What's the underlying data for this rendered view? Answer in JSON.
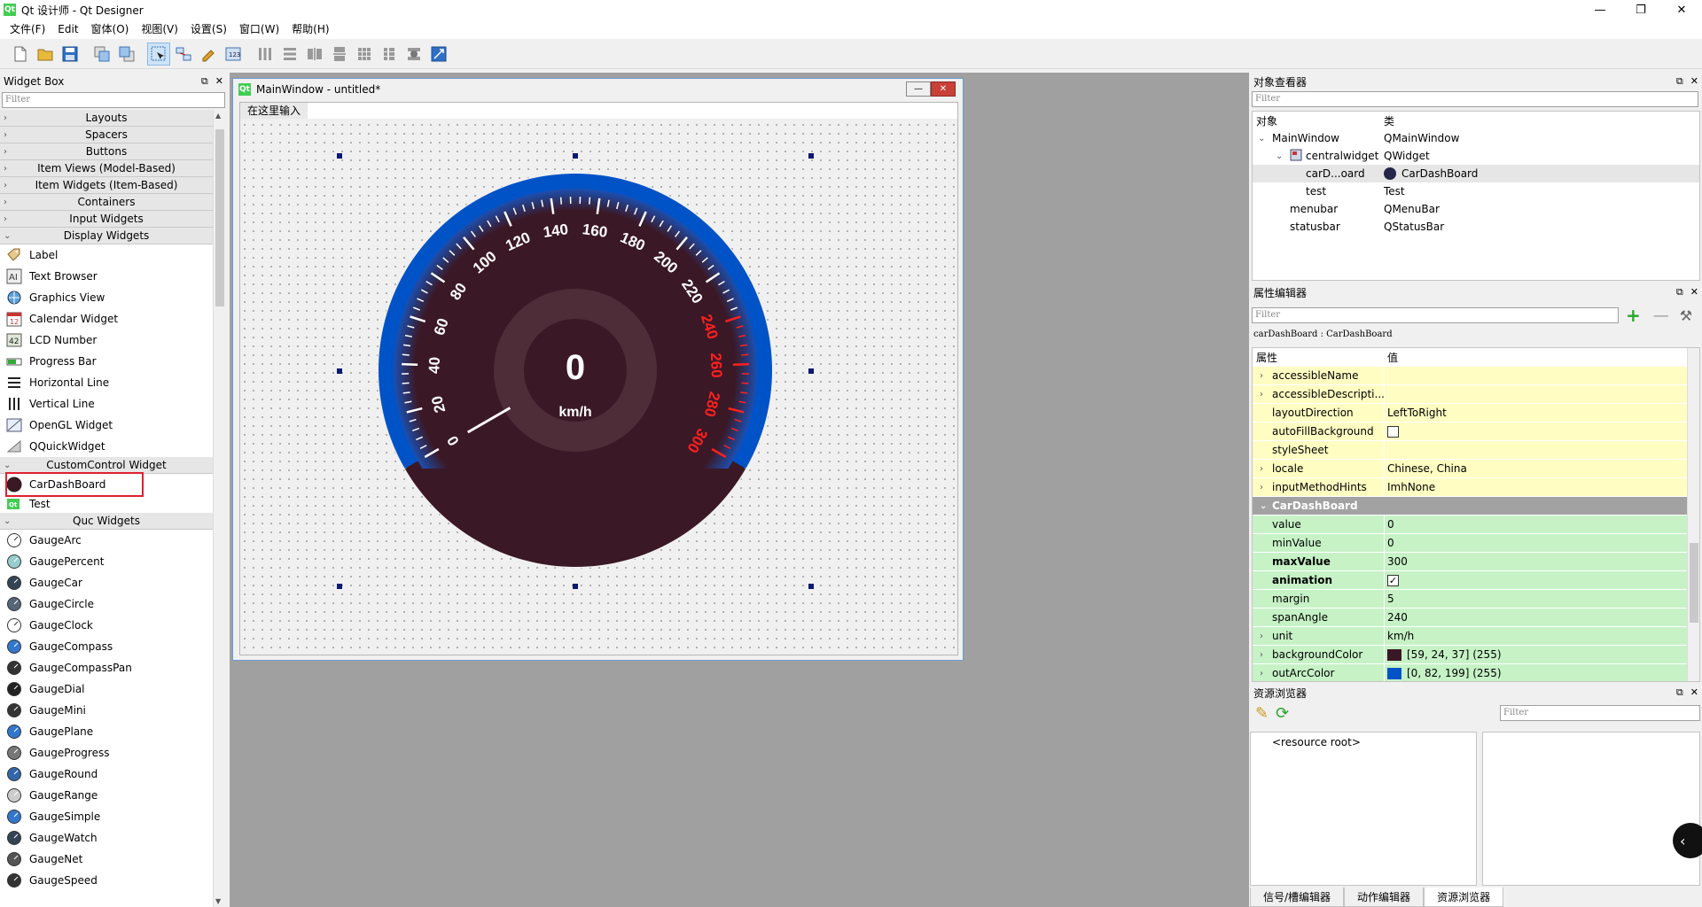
{
  "window": {
    "title": "Qt 设计师 - Qt Designer",
    "logo": "Qt",
    "min": "—",
    "max": "❐",
    "close": "✕"
  },
  "menubar": {
    "items": [
      "文件(F)",
      "Edit",
      "窗体(O)",
      "视图(V)",
      "设置(S)",
      "窗口(W)",
      "帮助(H)"
    ]
  },
  "widget_box": {
    "title": "Widget Box",
    "filter_placeholder": "Filter",
    "categories_top": [
      "Layouts",
      "Spacers",
      "Buttons",
      "Item Views (Model-Based)",
      "Item Widgets (Item-Based)",
      "Containers",
      "Input Widgets"
    ],
    "display_cat": "Display Widgets",
    "display_items": [
      "Label",
      "Text Browser",
      "Graphics View",
      "Calendar Widget",
      "LCD Number",
      "Progress Bar",
      "Horizontal Line",
      "Vertical Line",
      "OpenGL Widget",
      "QQuickWidget"
    ],
    "custom_cat": "CustomControl Widget",
    "custom_items": [
      "CarDashBoard",
      "Test"
    ],
    "quc_cat": "Quc Widgets",
    "quc_items": [
      "GaugeArc",
      "GaugePercent",
      "GaugeCar",
      "GaugeCircle",
      "GaugeClock",
      "GaugeCompass",
      "GaugeCompassPan",
      "GaugeDial",
      "GaugeMini",
      "GaugePlane",
      "GaugeProgress",
      "GaugeRound",
      "GaugeRange",
      "GaugeSimple",
      "GaugeWatch",
      "GaugeNet",
      "GaugeSpeed"
    ]
  },
  "form": {
    "title": "MainWindow - untitled*",
    "menu_placeholder": "在这里输入",
    "min": "—",
    "close": "✕"
  },
  "dashboard": {
    "value": "0",
    "unit": "km/h",
    "min": 0,
    "max": 300,
    "span_angle": 240,
    "ticks": [
      "0",
      "20",
      "40",
      "60",
      "80",
      "100",
      "120",
      "140",
      "160",
      "180",
      "200",
      "220",
      "240",
      "260",
      "280",
      "300"
    ],
    "background_color": "#3b1825",
    "out_arc_color": "#0052c7",
    "danger_color": "#ff2020"
  },
  "object_inspector": {
    "title": "对象查看器",
    "filter_placeholder": "Filter",
    "col_object": "对象",
    "col_class": "类",
    "rows": [
      {
        "obj": "MainWindow",
        "cls": "QMainWindow"
      },
      {
        "obj": "centralwidget",
        "cls": "QWidget"
      },
      {
        "obj": "carD...oard",
        "cls": "CarDashBoard"
      },
      {
        "obj": "test",
        "cls": "Test"
      },
      {
        "obj": "menubar",
        "cls": "QMenuBar"
      },
      {
        "obj": "statusbar",
        "cls": "QStatusBar"
      }
    ]
  },
  "property_editor": {
    "title": "属性编辑器",
    "filter_placeholder": "Filter",
    "object_path": "carDashBoard : CarDashBoard",
    "col_prop": "属性",
    "col_value": "值",
    "rows_yellow": [
      {
        "name": "accessibleName",
        "value": ""
      },
      {
        "name": "accessibleDescripti...",
        "value": ""
      },
      {
        "name": "layoutDirection",
        "value": "LeftToRight"
      },
      {
        "name": "autoFillBackground",
        "value": ""
      },
      {
        "name": "styleSheet",
        "value": ""
      },
      {
        "name": "locale",
        "value": "Chinese, China"
      },
      {
        "name": "inputMethodHints",
        "value": "ImhNone"
      }
    ],
    "group": "CarDashBoard",
    "rows_green": [
      {
        "name": "value",
        "value": "0"
      },
      {
        "name": "minValue",
        "value": "0"
      },
      {
        "name": "maxValue",
        "value": "300"
      },
      {
        "name": "animation",
        "value": ""
      },
      {
        "name": "margin",
        "value": "5"
      },
      {
        "name": "spanAngle",
        "value": "240"
      },
      {
        "name": "unit",
        "value": "km/h"
      },
      {
        "name": "backgroundColor",
        "value": "[59, 24, 37] (255)"
      },
      {
        "name": "outArcColor",
        "value": "[0, 82, 199] (255)"
      }
    ]
  },
  "resource_browser": {
    "title": "资源浏览器",
    "filter_placeholder": "Filter",
    "root": "<resource root>"
  },
  "bottom_tabs": [
    "信号/槽编辑器",
    "动作编辑器",
    "资源浏览器"
  ]
}
